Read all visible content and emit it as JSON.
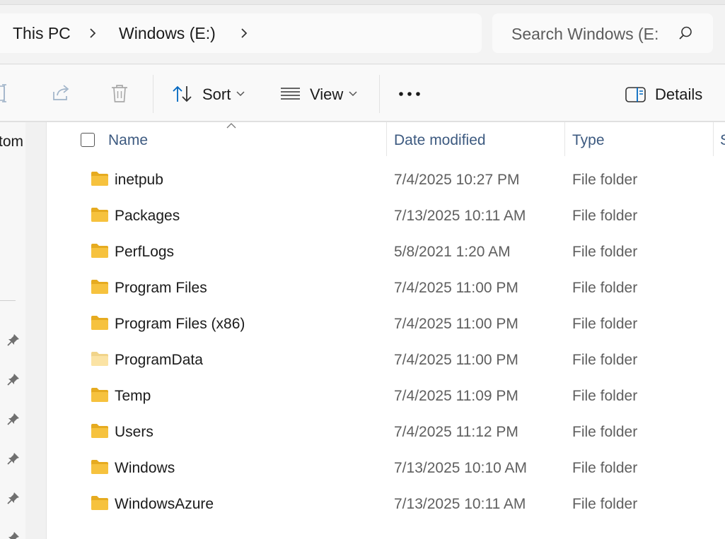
{
  "breadcrumb": {
    "items": [
      {
        "label": "This PC"
      },
      {
        "label": "Windows (E:)"
      }
    ]
  },
  "search": {
    "placeholder": "Search Windows (E:)"
  },
  "toolbar": {
    "sort_label": "Sort",
    "view_label": "View",
    "more_label": "•••",
    "details_label": "Details",
    "icons": [
      "rename-icon",
      "share-icon",
      "delete-icon",
      "sort-icon",
      "view-icon",
      "more-icon",
      "details-pane-icon"
    ]
  },
  "nav": {
    "partial_label": "tom",
    "pinned_count": 6
  },
  "columns": {
    "name": "Name",
    "date": "Date modified",
    "type": "Type",
    "size": "S"
  },
  "colors": {
    "folder": "#f6c23e",
    "folder_hidden": "#fbe3a4",
    "header_text": "#3d5a80",
    "accent": "#0067c0"
  },
  "files": [
    {
      "name": "inetpub",
      "date": "7/4/2025 10:27 PM",
      "type": "File folder",
      "hidden": false
    },
    {
      "name": "Packages",
      "date": "7/13/2025 10:11 AM",
      "type": "File folder",
      "hidden": false
    },
    {
      "name": "PerfLogs",
      "date": "5/8/2021 1:20 AM",
      "type": "File folder",
      "hidden": false
    },
    {
      "name": "Program Files",
      "date": "7/4/2025 11:00 PM",
      "type": "File folder",
      "hidden": false
    },
    {
      "name": "Program Files (x86)",
      "date": "7/4/2025 11:00 PM",
      "type": "File folder",
      "hidden": false
    },
    {
      "name": "ProgramData",
      "date": "7/4/2025 11:00 PM",
      "type": "File folder",
      "hidden": true
    },
    {
      "name": "Temp",
      "date": "7/4/2025 11:09 PM",
      "type": "File folder",
      "hidden": false
    },
    {
      "name": "Users",
      "date": "7/4/2025 11:12 PM",
      "type": "File folder",
      "hidden": false
    },
    {
      "name": "Windows",
      "date": "7/13/2025 10:10 AM",
      "type": "File folder",
      "hidden": false
    },
    {
      "name": "WindowsAzure",
      "date": "7/13/2025 10:11 AM",
      "type": "File folder",
      "hidden": false
    }
  ]
}
